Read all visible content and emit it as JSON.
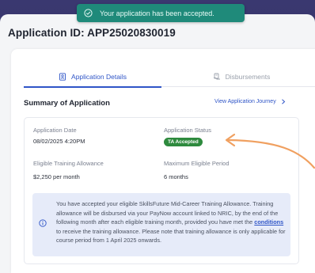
{
  "toast": {
    "message": "Your application has been accepted.",
    "icon": "check-circle-icon",
    "color": "#1f8a7a"
  },
  "header": {
    "application_id": "Application ID: APP25020830019"
  },
  "tabs": [
    {
      "label": "Application Details",
      "icon": "document-icon",
      "active": true
    },
    {
      "label": "Disbursements",
      "icon": "disbursement-icon",
      "active": false
    }
  ],
  "summary": {
    "title": "Summary of Application",
    "journey_link": "View Application Journey"
  },
  "details": {
    "application_date_label": "Application Date",
    "application_date": "08/02/2025 4:20PM",
    "application_status_label": "Application Status",
    "application_status": "TA Accepted",
    "status_color": "#2e8a3e",
    "allowance_label": "Eligible Training Allowance",
    "allowance_value": "$2,250 per month",
    "period_label": "Maximum Eligible Period",
    "period_value": "6 months"
  },
  "info": {
    "text_before_link": "You have accepted your eligible SkillsFuture Mid-Career Training Allowance. Training allowance will be disbursed via your PayNow account linked to NRIC, by the end of the following month after each eligible training month, provided you have met the ",
    "link_text": "conditions",
    "text_after_link": " to receive the training allowance. Please note that training allowance is only applicable for course period from 1 April 2025 onwards."
  },
  "colors": {
    "accent": "#2f55c7",
    "annotation_arrow": "#f0a060"
  }
}
